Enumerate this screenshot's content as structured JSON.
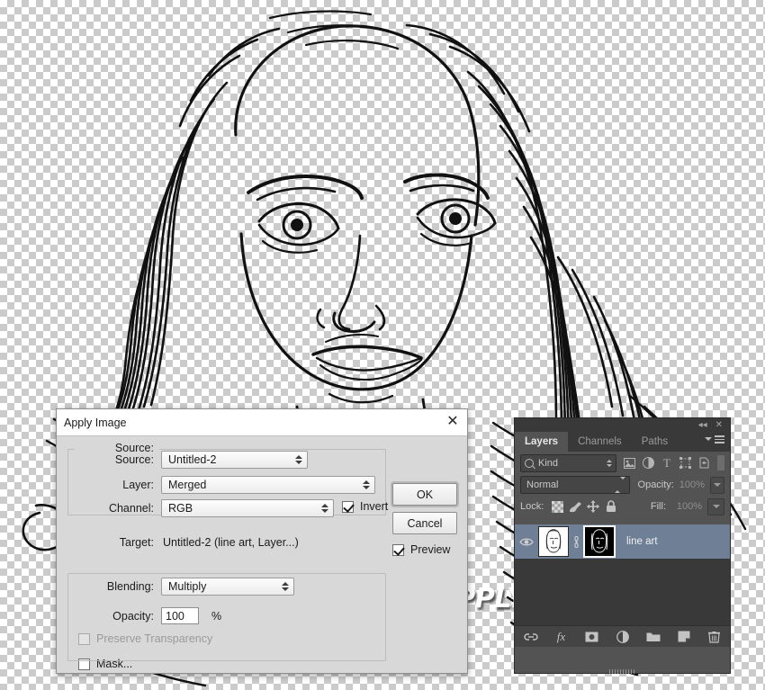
{
  "canvas": {
    "artwork_description": "line-art portrait of a woman on transparent background"
  },
  "dialog": {
    "title": "Apply Image",
    "close_icon": "close-icon",
    "source_group": {
      "source_label": "Source:",
      "source_value": "Untitled-2",
      "layer_label": "Layer:",
      "layer_value": "Merged",
      "channel_label": "Channel:",
      "channel_value": "RGB",
      "invert_label": "Invert",
      "invert_checked": true
    },
    "target_label": "Target:",
    "target_value": "Untitled-2 (line art, Layer...)",
    "blending_group": {
      "blending_label": "Blending:",
      "blending_value": "Multiply",
      "opacity_label": "Opacity:",
      "opacity_value": "100",
      "percent_symbol": "%",
      "preserve_label": "Preserve Transparency",
      "preserve_checked": false,
      "preserve_disabled": true,
      "mask_label": "Mask...",
      "mask_checked": false
    },
    "ok_label": "OK",
    "cancel_label": "Cancel",
    "preview_label": "Preview",
    "preview_checked": true
  },
  "layers_panel": {
    "collapse_icon": "collapse-double-arrow-icon",
    "close_icon": "close-icon",
    "menu_icon": "panel-menu-icon",
    "tabs": [
      {
        "label": "Layers",
        "active": true
      },
      {
        "label": "Channels",
        "active": false
      },
      {
        "label": "Paths",
        "active": false
      }
    ],
    "filter": {
      "search_icon": "search-icon",
      "kind_value": "Kind",
      "icons": [
        "pixel-layer-filter-icon",
        "adjustment-layer-filter-icon",
        "type-layer-filter-icon",
        "shape-layer-filter-icon",
        "smart-object-filter-icon"
      ],
      "toggle_name": "filter-enable-toggle"
    },
    "blend_mode": "Normal",
    "opacity_label": "Opacity:",
    "opacity_value": "100%",
    "lock_label": "Lock:",
    "lock_icons": [
      "lock-transparency-icon",
      "lock-image-pixels-icon",
      "lock-position-icon",
      "lock-all-icon"
    ],
    "fill_label": "Fill:",
    "fill_value": "100%",
    "layers": [
      {
        "name": "line art",
        "visible": true,
        "selected": true,
        "eye_icon": "eye-icon",
        "link_icon": "link-mask-icon",
        "thumbnail_name": "layer-thumbnail",
        "mask_thumbnail_name": "layer-mask-thumbnail"
      }
    ],
    "bottom_icons": [
      "link-layers-icon",
      "layer-styles-fx-icon",
      "add-layer-mask-icon",
      "new-adjustment-layer-icon",
      "new-group-icon",
      "new-layer-icon",
      "delete-layer-icon"
    ]
  },
  "watermark": {
    "text": "PHOTOSHOPSUPPLY.COM"
  },
  "colors": {
    "dialog_bg": "#d8d8d8",
    "panel_bg": "#535353",
    "panel_dark": "#393939",
    "selection_blue": "#6f7f96",
    "checker_gray": "#cbcbcb"
  }
}
